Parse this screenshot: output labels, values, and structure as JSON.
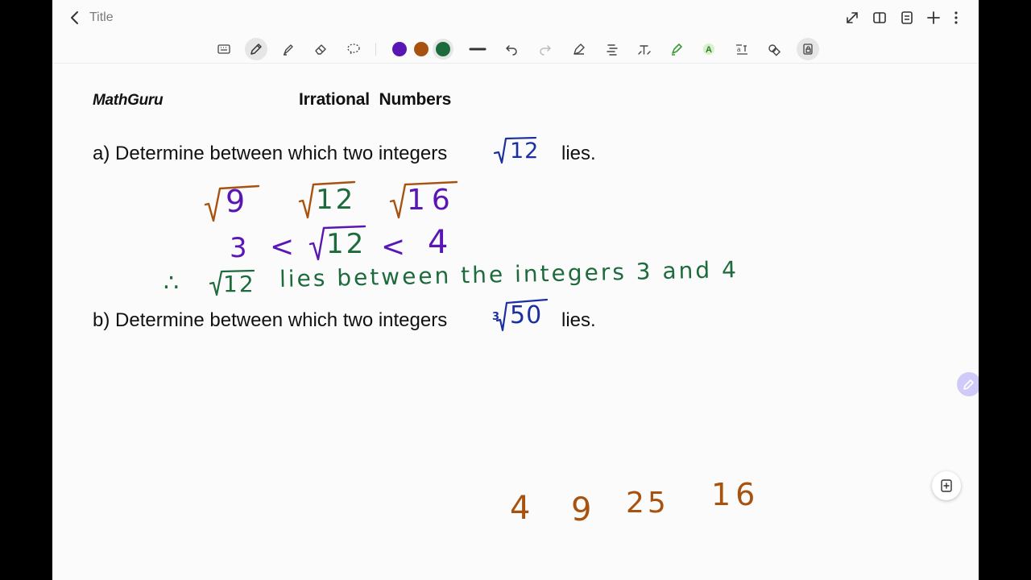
{
  "header": {
    "title": "Title",
    "icons": [
      "back-chevron-icon",
      "expand-icon",
      "book-view-icon",
      "page-list-icon",
      "add-icon",
      "more-vertical-icon"
    ]
  },
  "toolbar": {
    "tools": [
      "keyboard-icon",
      "pen-icon",
      "highlighter-icon",
      "eraser-icon",
      "lasso-icon",
      "line-icon",
      "undo-icon",
      "redo-icon",
      "shape-icon",
      "text-align-icon",
      "text-icon",
      "highlighter-marker-icon",
      "ai-text-icon",
      "translate-icon",
      "shapes-icon",
      "lock-icon"
    ],
    "selected_tool": "pen",
    "colors": {
      "purple": "#5a16b5",
      "brown": "#a8520f",
      "green": "#1d6b3c"
    },
    "selected_color": "green"
  },
  "note": {
    "brand": "MathGuru",
    "heading": "Irrational  Numbers",
    "question_a": {
      "text": "a) Determine between which two integers",
      "radicand": "12",
      "suffix": "lies."
    },
    "question_b": {
      "text": "b) Determine between which two integers",
      "index": "3",
      "radicand": "50",
      "suffix": "lies."
    },
    "ink": {
      "line1": {
        "radicands": [
          "9",
          "12",
          "16"
        ]
      },
      "line2": {
        "left": "3",
        "op1": "<",
        "radicand": "12",
        "op2": "<",
        "right": "4"
      },
      "line3": {
        "therefore": "∴",
        "radicand": "12",
        "text": "lies between the integers  3 and 4"
      },
      "numbers": [
        "4",
        "9",
        "25",
        "16"
      ]
    }
  },
  "ink_colors": {
    "blue": "#1b2fa0",
    "purple": "#5a16b5",
    "brown": "#a8520f",
    "green": "#1d6b3c"
  }
}
